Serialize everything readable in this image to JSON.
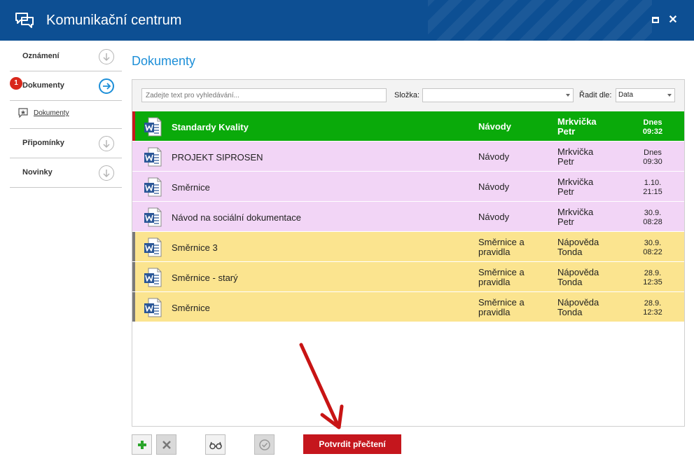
{
  "window": {
    "title": "Komunikační centrum"
  },
  "sidebar": {
    "items": [
      {
        "label": "Oznámení"
      },
      {
        "label": "Dokumenty",
        "badge": "1",
        "sub": "Dokumenty"
      },
      {
        "label": "Připomínky"
      },
      {
        "label": "Novinky"
      }
    ]
  },
  "main": {
    "heading": "Dokumenty",
    "filters": {
      "search_placeholder": "Zadejte text pro vyhledávání...",
      "folder_label": "Složka:",
      "folder_value": "",
      "sort_label": "Řadit dle:",
      "sort_value": "Data"
    },
    "documents": [
      {
        "name": "Standardy Kvality",
        "category": "Návody",
        "author_line1": "Mrkvička",
        "author_line2": "Petr",
        "date": "Dnes",
        "time": "09:32",
        "row_color": "#0aaa0a",
        "stripe_color": "#c8171e",
        "bold": true
      },
      {
        "name": "PROJEKT SIPROSEN",
        "category": "Návody",
        "author_line1": "Mrkvička",
        "author_line2": "Petr",
        "date": "Dnes",
        "time": "09:30",
        "row_color": "#f2d5f6",
        "stripe_color": "#f2d5f6"
      },
      {
        "name": "Směrnice",
        "category": "Návody",
        "author_line1": "Mrkvička",
        "author_line2": "Petr",
        "date": "1.10.",
        "time": "21:15",
        "row_color": "#f2d5f6",
        "stripe_color": "#f2d5f6"
      },
      {
        "name": "Návod na sociální dokumentace",
        "category": "Návody",
        "author_line1": "Mrkvička",
        "author_line2": "Petr",
        "date": "30.9.",
        "time": "08:28",
        "row_color": "#f2d5f6",
        "stripe_color": "#f2d5f6"
      },
      {
        "name": "Směrnice 3",
        "category_line1": "Směrnice a",
        "category_line2": "pravidla",
        "author_line1": "Nápověda",
        "author_line2": "Tonda",
        "date": "30.9.",
        "time": "08:22",
        "row_color": "#fbe48f",
        "stripe_color": "#7a7a7a"
      },
      {
        "name": "Směrnice - starý",
        "category_line1": "Směrnice a",
        "category_line2": "pravidla",
        "author_line1": "Nápověda",
        "author_line2": "Tonda",
        "date": "28.9.",
        "time": "12:35",
        "row_color": "#fbe48f",
        "stripe_color": "#7a7a7a"
      },
      {
        "name": "Směrnice",
        "category_line1": "Směrnice a",
        "category_line2": "pravidla",
        "author_line1": "Nápověda",
        "author_line2": "Tonda",
        "date": "28.9.",
        "time": "12:32",
        "row_color": "#fbe48f",
        "stripe_color": "#7a7a7a"
      }
    ]
  },
  "toolbar": {
    "confirm_label": "Potvrdit přečtení"
  },
  "colors": {
    "accent": "#1d8fd8",
    "titlebar": "#0d4f93",
    "confirm": "#c5161d"
  }
}
